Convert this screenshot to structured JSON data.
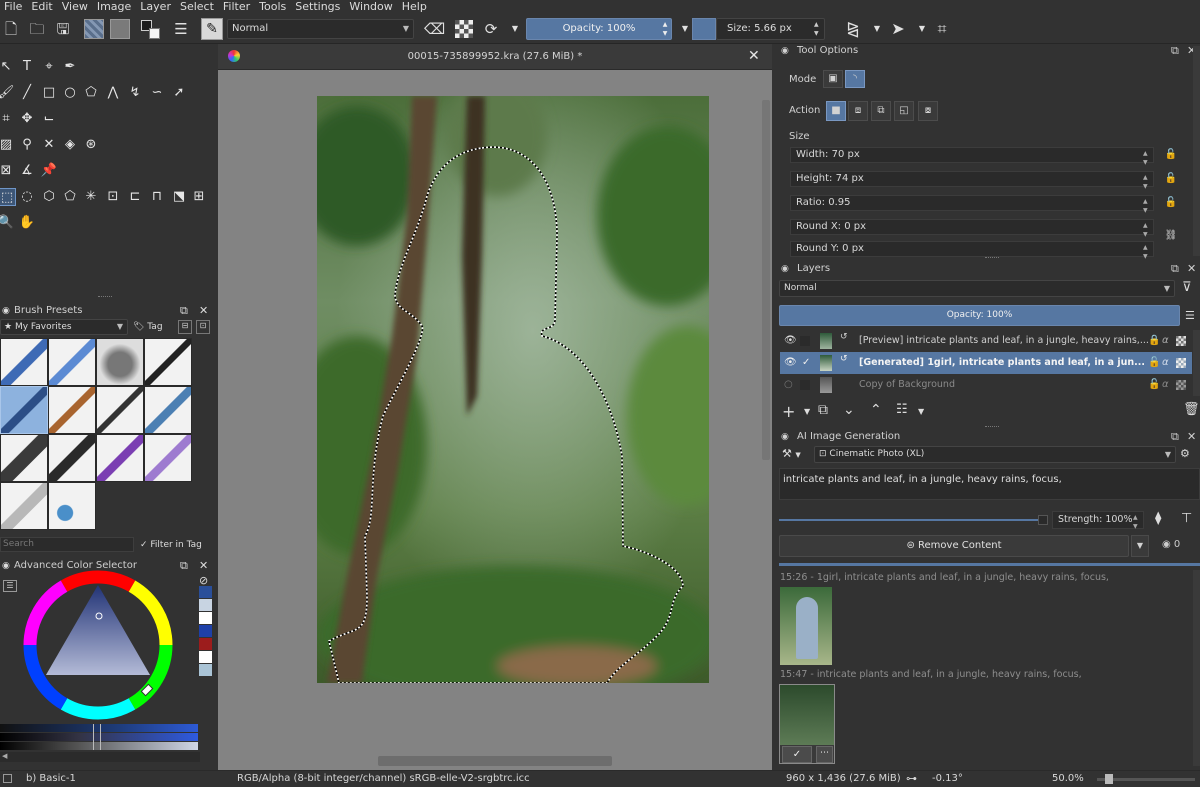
{
  "menu": [
    "File",
    "Edit",
    "View",
    "Image",
    "Layer",
    "Select",
    "Filter",
    "Tools",
    "Settings",
    "Window",
    "Help"
  ],
  "toolbar": {
    "blend_mode": "Normal",
    "opacity_label": "Opacity: 100%",
    "opacity": 1.0,
    "size_label": "Size: 5.66 px"
  },
  "document": {
    "tab_title": "00015-735899952.kra (27.6 MiB) *"
  },
  "brush_presets": {
    "title": "Brush Presets",
    "tag_filter": "My Favorites",
    "tag_label": "Tag",
    "search_placeholder": "Search",
    "filter_in_tag": "Filter in Tag"
  },
  "color_selector": {
    "title": "Advanced Color Selector",
    "swatches": [
      "#2a4f9a",
      "#c8d4e2",
      "#ffffff",
      "#1e40a8",
      "#9c1c1c",
      "#ffffff",
      "#cfd9e2",
      "#aac4d6"
    ]
  },
  "tool_options": {
    "title": "Tool Options",
    "mode_label": "Mode",
    "action_label": "Action",
    "size_label": "Size",
    "width": "Width: 70 px",
    "height": "Height: 74 px",
    "ratio": "Ratio: 0.95",
    "round_x": "Round X: 0 px",
    "round_y": "Round Y: 0 px"
  },
  "layers": {
    "title": "Layers",
    "blend_mode": "Normal",
    "opacity_label": "Opacity:  100%",
    "items": [
      {
        "name": "[Preview] intricate plants and leaf, in a jungle, heavy rains,...",
        "selected": false,
        "visible": true
      },
      {
        "name": "[Generated] 1girl, intricate plants and leaf, in a jun...",
        "selected": true,
        "visible": true
      },
      {
        "name": "Copy of Background",
        "selected": false,
        "visible": false
      }
    ]
  },
  "ai_generation": {
    "title": "AI Image Generation",
    "style": "Cinematic Photo (XL)",
    "prompt": "intricate plants and leaf, in a jungle, heavy rains, focus,",
    "strength_label": "Strength: 100%",
    "action_button": "Remove Content",
    "queue_count": "0",
    "history": [
      {
        "label": "15:26 - 1girl, intricate plants and leaf, in a jungle, heavy rains, focus,"
      },
      {
        "label": "15:47 - intricate plants and leaf, in a jungle, heavy rains, focus,"
      }
    ]
  },
  "status": {
    "brush": "b) Basic-1",
    "color_model": "RGB/Alpha (8-bit integer/channel)  sRGB-elle-V2-srgbtrc.icc",
    "dimensions": "960 x 1,436 (27.6 MiB)",
    "rotation": "-0.13°",
    "zoom": "50.0%"
  }
}
